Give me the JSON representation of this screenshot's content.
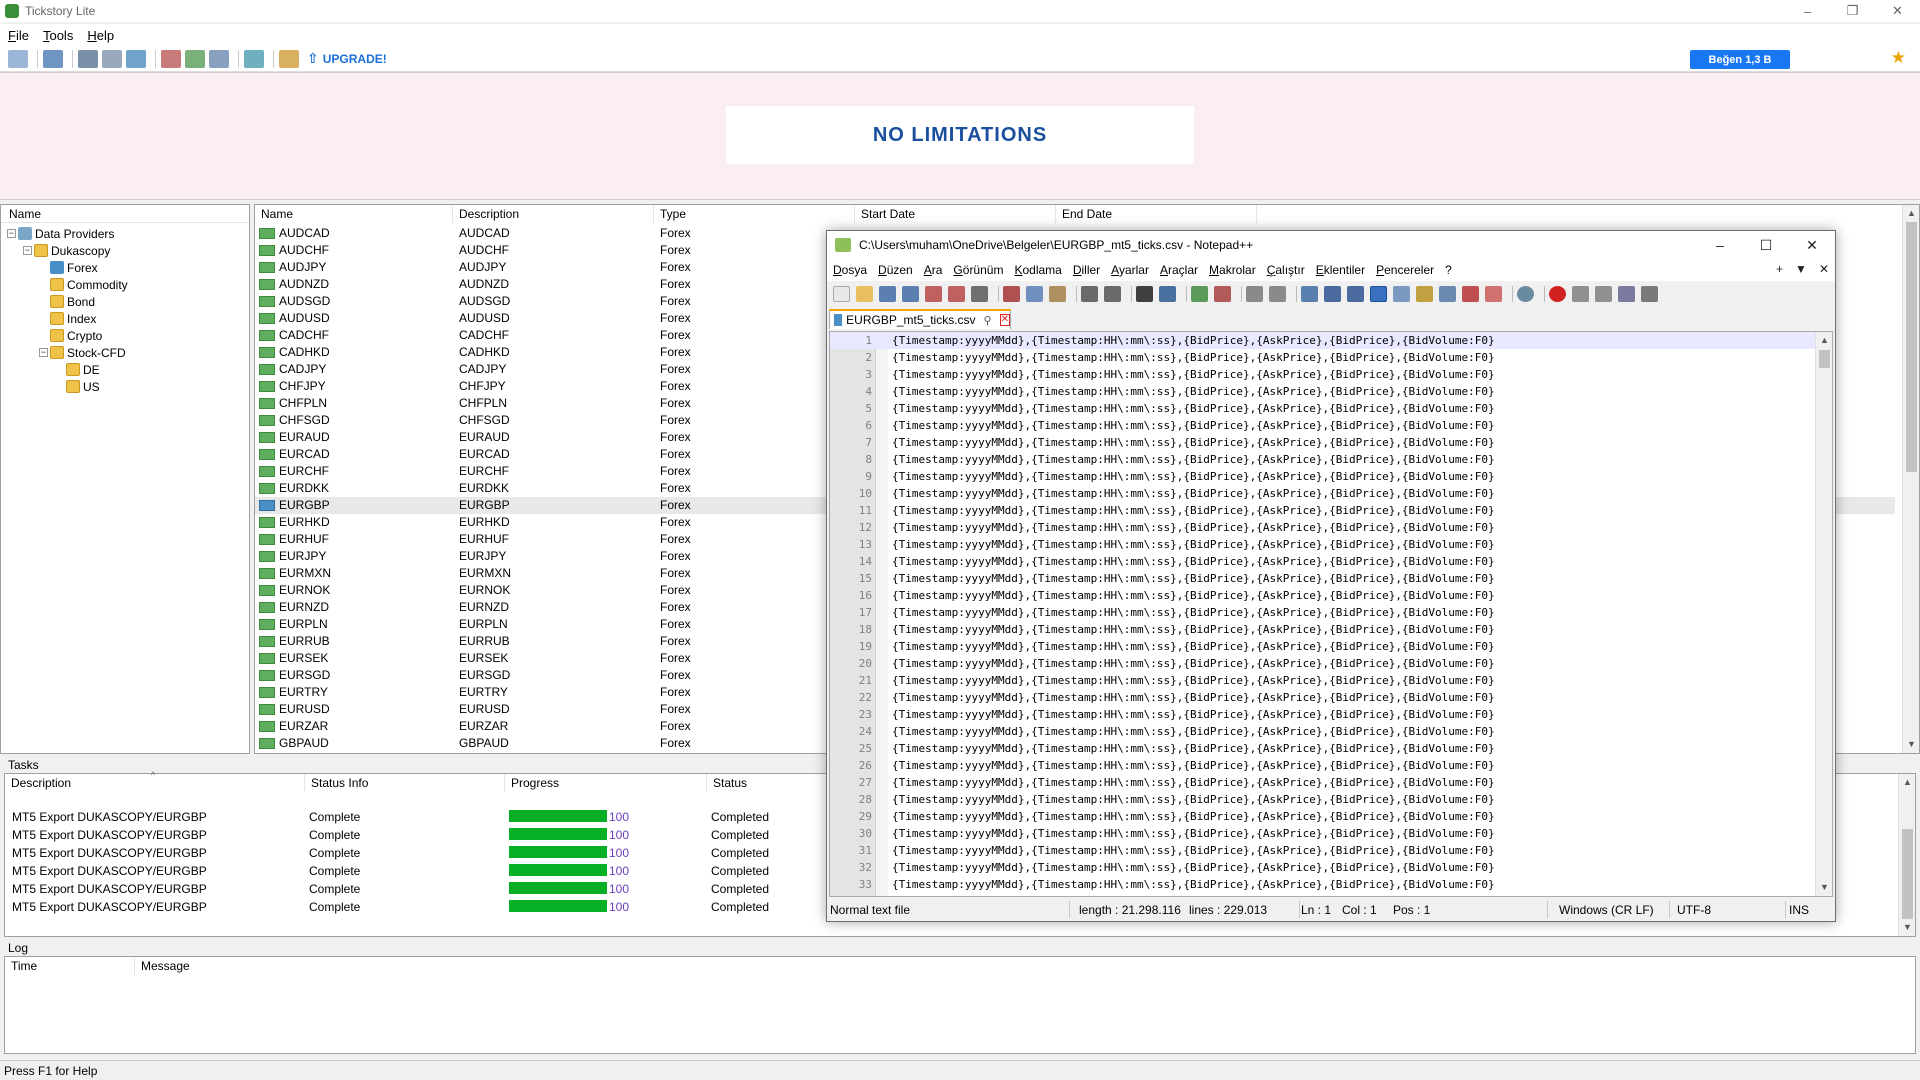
{
  "app": {
    "title": "Tickstory Lite",
    "window_controls": [
      "–",
      "❐",
      "✕"
    ],
    "menu": [
      "File",
      "Tools",
      "Help"
    ],
    "toolbar": {
      "upgrade_label": "UPGRADE!"
    },
    "fb_like": "Beğen 1,3 B",
    "banner": "NO LIMITATIONS",
    "status_bar": "Press F1 for Help"
  },
  "tree": {
    "header": "Name",
    "items": [
      {
        "label": "Data Providers",
        "level": 0,
        "expander": "−",
        "icon": "network"
      },
      {
        "label": "Dukascopy",
        "level": 1,
        "expander": "−",
        "icon": "folder"
      },
      {
        "label": "Forex",
        "level": 2,
        "expander": "",
        "icon": "forex"
      },
      {
        "label": "Commodity",
        "level": 2,
        "expander": "",
        "icon": "folder"
      },
      {
        "label": "Bond",
        "level": 2,
        "expander": "",
        "icon": "folder"
      },
      {
        "label": "Index",
        "level": 2,
        "expander": "",
        "icon": "folder"
      },
      {
        "label": "Crypto",
        "level": 2,
        "expander": "",
        "icon": "folder"
      },
      {
        "label": "Stock-CFD",
        "level": 2,
        "expander": "−",
        "icon": "folder"
      },
      {
        "label": "DE",
        "level": 3,
        "expander": "",
        "icon": "folder"
      },
      {
        "label": "US",
        "level": 3,
        "expander": "",
        "icon": "folder"
      }
    ]
  },
  "instruments": {
    "headers": [
      "Name",
      "Description",
      "Type",
      "Start Date",
      "End Date"
    ],
    "selected": "EURGBP",
    "rows": [
      {
        "name": "AUDCAD",
        "desc": "AUDCAD",
        "type": "Forex"
      },
      {
        "name": "AUDCHF",
        "desc": "AUDCHF",
        "type": "Forex"
      },
      {
        "name": "AUDJPY",
        "desc": "AUDJPY",
        "type": "Forex"
      },
      {
        "name": "AUDNZD",
        "desc": "AUDNZD",
        "type": "Forex"
      },
      {
        "name": "AUDSGD",
        "desc": "AUDSGD",
        "type": "Forex"
      },
      {
        "name": "AUDUSD",
        "desc": "AUDUSD",
        "type": "Forex"
      },
      {
        "name": "CADCHF",
        "desc": "CADCHF",
        "type": "Forex"
      },
      {
        "name": "CADHKD",
        "desc": "CADHKD",
        "type": "Forex"
      },
      {
        "name": "CADJPY",
        "desc": "CADJPY",
        "type": "Forex"
      },
      {
        "name": "CHFJPY",
        "desc": "CHFJPY",
        "type": "Forex"
      },
      {
        "name": "CHFPLN",
        "desc": "CHFPLN",
        "type": "Forex"
      },
      {
        "name": "CHFSGD",
        "desc": "CHFSGD",
        "type": "Forex"
      },
      {
        "name": "EURAUD",
        "desc": "EURAUD",
        "type": "Forex"
      },
      {
        "name": "EURCAD",
        "desc": "EURCAD",
        "type": "Forex"
      },
      {
        "name": "EURCHF",
        "desc": "EURCHF",
        "type": "Forex"
      },
      {
        "name": "EURDKK",
        "desc": "EURDKK",
        "type": "Forex"
      },
      {
        "name": "EURGBP",
        "desc": "EURGBP",
        "type": "Forex"
      },
      {
        "name": "EURHKD",
        "desc": "EURHKD",
        "type": "Forex"
      },
      {
        "name": "EURHUF",
        "desc": "EURHUF",
        "type": "Forex"
      },
      {
        "name": "EURJPY",
        "desc": "EURJPY",
        "type": "Forex"
      },
      {
        "name": "EURMXN",
        "desc": "EURMXN",
        "type": "Forex"
      },
      {
        "name": "EURNOK",
        "desc": "EURNOK",
        "type": "Forex"
      },
      {
        "name": "EURNZD",
        "desc": "EURNZD",
        "type": "Forex"
      },
      {
        "name": "EURPLN",
        "desc": "EURPLN",
        "type": "Forex"
      },
      {
        "name": "EURRUB",
        "desc": "EURRUB",
        "type": "Forex"
      },
      {
        "name": "EURSEK",
        "desc": "EURSEK",
        "type": "Forex"
      },
      {
        "name": "EURSGD",
        "desc": "EURSGD",
        "type": "Forex"
      },
      {
        "name": "EURTRY",
        "desc": "EURTRY",
        "type": "Forex"
      },
      {
        "name": "EURUSD",
        "desc": "EURUSD",
        "type": "Forex"
      },
      {
        "name": "EURZAR",
        "desc": "EURZAR",
        "type": "Forex"
      },
      {
        "name": "GBPAUD",
        "desc": "GBPAUD",
        "type": "Forex"
      }
    ]
  },
  "tasks": {
    "label": "Tasks",
    "headers": [
      "Description",
      "Status Info",
      "Progress",
      "Status"
    ],
    "rows": [
      {
        "desc": "MT5 Export DUKASCOPY/EURGBP",
        "info": "Complete",
        "progress": 100,
        "status": "Completed"
      },
      {
        "desc": "MT5 Export DUKASCOPY/EURGBP",
        "info": "Complete",
        "progress": 100,
        "status": "Completed"
      },
      {
        "desc": "MT5 Export DUKASCOPY/EURGBP",
        "info": "Complete",
        "progress": 100,
        "status": "Completed"
      },
      {
        "desc": "MT5 Export DUKASCOPY/EURGBP",
        "info": "Complete",
        "progress": 100,
        "status": "Completed"
      },
      {
        "desc": "MT5 Export DUKASCOPY/EURGBP",
        "info": "Complete",
        "progress": 100,
        "status": "Completed"
      },
      {
        "desc": "MT5 Export DUKASCOPY/EURGBP",
        "info": "Complete",
        "progress": 100,
        "status": "Completed"
      }
    ]
  },
  "log": {
    "label": "Log",
    "headers": [
      "Time",
      "Message"
    ]
  },
  "notepad": {
    "title": "C:\\Users\\muham\\OneDrive\\Belgeler\\EURGBP_mt5_ticks.csv - Notepad++",
    "window_controls": [
      "–",
      "☐",
      "✕"
    ],
    "menu": [
      "Dosya",
      "Düzen",
      "Ara",
      "Görünüm",
      "Kodlama",
      "Diller",
      "Ayarlar",
      "Araçlar",
      "Makrolar",
      "Çalıştır",
      "Eklentiler",
      "Pencereler",
      "?"
    ],
    "menu_right": [
      "+",
      "▼",
      "✕"
    ],
    "tab": {
      "label": "EURGBP_mt5_ticks.csv",
      "pin": "⚲",
      "close": "✕"
    },
    "line_text": "{Timestamp:yyyyMMdd},{Timestamp:HH\\:mm\\:ss},{BidPrice},{AskPrice},{BidPrice},{BidVolume:F0}",
    "line_count": 33,
    "status": {
      "type": "Normal text file",
      "length": "length : 21.298.116",
      "lines": "lines : 229.013",
      "ln": "Ln : 1",
      "col": "Col : 1",
      "pos": "Pos : 1",
      "eol": "Windows (CR LF)",
      "encoding": "UTF-8",
      "mode": "INS"
    }
  },
  "colors": {
    "progress": "#06b025",
    "accent": "#1b6fd6",
    "banner_bg": "#fbeef2",
    "tab_accent": "#f7a500"
  }
}
